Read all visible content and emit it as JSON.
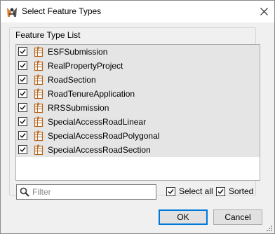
{
  "window": {
    "title": "Select Feature Types"
  },
  "group": {
    "legend": "Feature Type List"
  },
  "feature_types": [
    {
      "label": "ESFSubmission",
      "checked": true
    },
    {
      "label": "RealPropertyProject",
      "checked": true
    },
    {
      "label": "RoadSection",
      "checked": true
    },
    {
      "label": "RoadTenureApplication",
      "checked": true
    },
    {
      "label": "RRSSubmission",
      "checked": true
    },
    {
      "label": "SpecialAccessRoadLinear",
      "checked": true
    },
    {
      "label": "SpecialAccessRoadPolygonal",
      "checked": true
    },
    {
      "label": "SpecialAccessRoadSection",
      "checked": true
    }
  ],
  "filter": {
    "placeholder": "Filter",
    "value": ""
  },
  "options": {
    "select_all": {
      "label": "Select all",
      "checked": true
    },
    "sorted": {
      "label": "Sorted",
      "checked": true
    }
  },
  "buttons": {
    "ok": "OK",
    "cancel": "Cancel"
  },
  "icons": {
    "app": "fme-workbench-icon",
    "close": "close-icon",
    "feature_type": "feature-table-icon",
    "search": "search-icon",
    "check": "checkmark-icon"
  },
  "colors": {
    "accent": "#0078d7",
    "item_background": "#e5e5e5",
    "feature_icon": "#b5651d",
    "dialog_background": "#f0f0f0"
  }
}
